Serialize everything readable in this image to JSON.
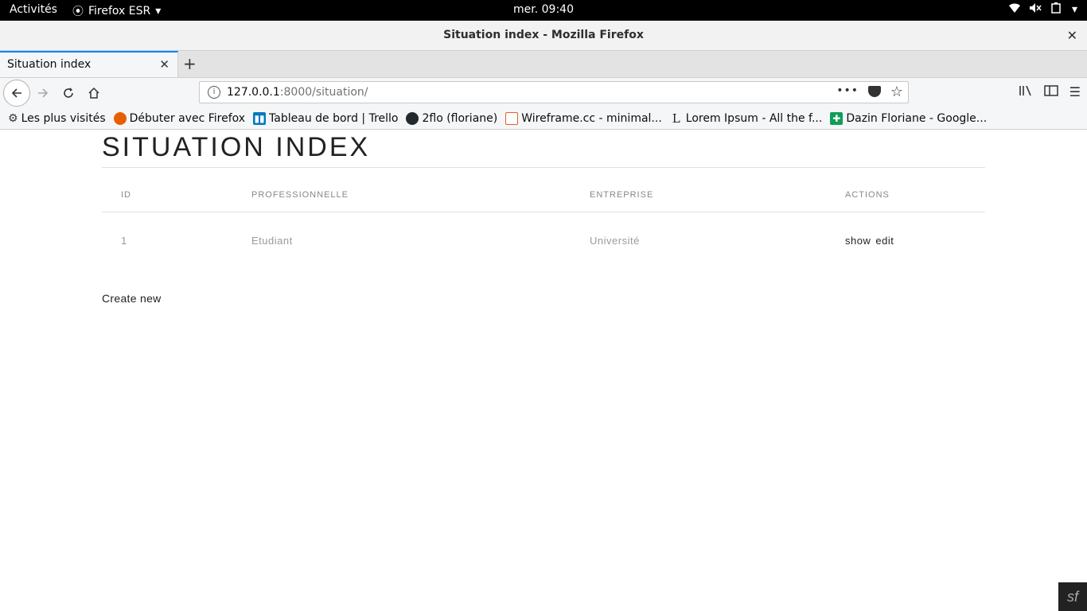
{
  "topbar": {
    "activities": "Activités",
    "app_name": "Firefox ESR",
    "clock": "mer. 09:40"
  },
  "window": {
    "title": "Situation index - Mozilla Firefox"
  },
  "tabs": [
    {
      "label": "Situation index"
    }
  ],
  "urlbar": {
    "host": "127.0.0.1",
    "rest": ":8000/situation/",
    "page_actions": "•••"
  },
  "bookmarks": [
    {
      "label": "Les plus visités",
      "icon": "gear-icon"
    },
    {
      "label": "Débuter avec Firefox",
      "icon": "firefox-icon"
    },
    {
      "label": "Tableau de bord | Trello",
      "icon": "trello-icon"
    },
    {
      "label": "2flo (floriane)",
      "icon": "github-icon"
    },
    {
      "label": "Wireframe.cc - minimal...",
      "icon": "wireframe-icon"
    },
    {
      "label": "Lorem Ipsum - All the f...",
      "icon": "lorem-icon"
    },
    {
      "label": "Dazin Floriane - Google...",
      "icon": "google-sheets-icon"
    }
  ],
  "page": {
    "title": "SITUATION INDEX",
    "table": {
      "headers": [
        "ID",
        "PROFESSIONNELLE",
        "ENTREPRISE",
        "ACTIONS"
      ],
      "rows": [
        {
          "id": "1",
          "professionnelle": "Etudiant",
          "entreprise": "Université",
          "show": "show",
          "edit": "edit"
        }
      ]
    },
    "create_new": "Create new"
  },
  "colors": {
    "accent": "#0a84ff",
    "topbar": "#000000"
  }
}
